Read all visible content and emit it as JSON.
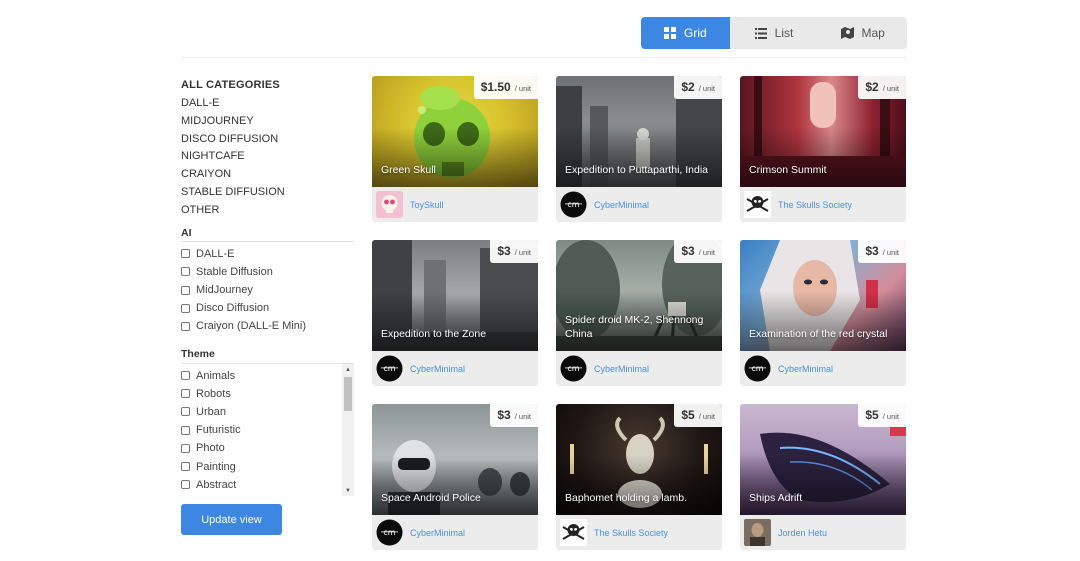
{
  "view_toggle": {
    "grid": "Grid",
    "list": "List",
    "map": "Map",
    "active": "grid"
  },
  "sidebar": {
    "all_categories": "ALL CATEGORIES",
    "categories": [
      "DALL-E",
      "MIDJOURNEY",
      "DISCO DIFFUSION",
      "NIGHTCAFE",
      "CRAIYON",
      "STABLE DIFFUSION",
      "OTHER"
    ],
    "ai_title": "AI",
    "ai_options": [
      "DALL-E",
      "Stable Diffusion",
      "MidJourney",
      "Disco Diffusion",
      "Craiyon (DALL-E Mini)"
    ],
    "theme_title": "Theme",
    "theme_options": [
      "Animals",
      "Robots",
      "Urban",
      "Futuristic",
      "Photo",
      "Painting",
      "Abstract"
    ],
    "update_button": "Update view"
  },
  "cards": [
    {
      "title": "Green Skull",
      "price": "$1.50",
      "unit": "/ unit",
      "author": "ToySkull"
    },
    {
      "title": "Expedition to Puttaparthi, India",
      "price": "$2",
      "unit": "/ unit",
      "author": "CyberMinimal"
    },
    {
      "title": "Crimson Summit",
      "price": "$2",
      "unit": "/ unit",
      "author": "The Skulls Society"
    },
    {
      "title": "Expedition to the Zone",
      "price": "$3",
      "unit": "/ unit",
      "author": "CyberMinimal"
    },
    {
      "title": "Spider droid MK-2, Shennong China",
      "price": "$3",
      "unit": "/ unit",
      "author": "CyberMinimal"
    },
    {
      "title": "Examination of the red crystal",
      "price": "$3",
      "unit": "/ unit",
      "author": "CyberMinimal"
    },
    {
      "title": "Space Android Police",
      "price": "$3",
      "unit": "/ unit",
      "author": "CyberMinimal"
    },
    {
      "title": "Baphomet holding a lamb.",
      "price": "$5",
      "unit": "/ unit",
      "author": "The Skulls Society"
    },
    {
      "title": "Ships Adrift",
      "price": "$5",
      "unit": "/ unit",
      "author": "Jorden Hetu"
    }
  ],
  "colors": {
    "accent": "#3d87e3",
    "link": "#4a90e2"
  }
}
